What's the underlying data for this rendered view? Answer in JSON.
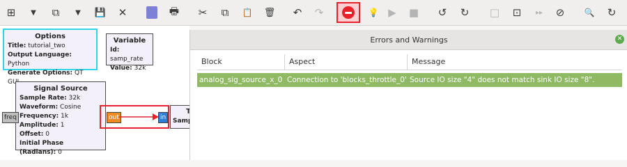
{
  "toolbar": {
    "new_icon": "⊞",
    "dropdown1": "▼",
    "open_icon": "⧉",
    "dropdown2": "▼",
    "save_icon": "💾",
    "close_icon": "✕",
    "print_icon": "🖶",
    "cut_icon": "✂",
    "copy_icon": "⧉",
    "paste_icon": "📋",
    "delete_icon": "🗑",
    "undo_icon": "↶",
    "redo_icon": "↷",
    "debug_icon": "💡",
    "run_icon": "▶",
    "stop_icon": "■",
    "rotate_ccw_icon": "↺",
    "rotate_cw_icon": "↻",
    "enable_icon": "□",
    "bypass_icon": "⊡",
    "forward_icon": "▸▸",
    "disable_icon": "⊘",
    "search_icon": "🔍",
    "reload_icon": "↻"
  },
  "blocks": {
    "options": {
      "title": "Options",
      "rows": [
        {
          "k": "Title:",
          "v": "tutorial_two"
        },
        {
          "k": "Output Language:",
          "v": "Python"
        },
        {
          "k": "Generate Options:",
          "v": "QT GUI"
        }
      ]
    },
    "variable": {
      "title": "Variable",
      "rows": [
        {
          "k": "Id:",
          "v": "samp_rate"
        },
        {
          "k": "Value:",
          "v": "32k"
        }
      ]
    },
    "signal_source": {
      "title": "Signal Source",
      "rows": [
        {
          "k": "Sample Rate:",
          "v": "32k"
        },
        {
          "k": "Waveform:",
          "v": "Cosine"
        },
        {
          "k": "Frequency:",
          "v": "1k"
        },
        {
          "k": "Amplitude:",
          "v": "1"
        },
        {
          "k": "Offset:",
          "v": "0"
        },
        {
          "k": "Initial Phase (Radians):",
          "v": "0"
        }
      ]
    },
    "throttle": {
      "title_fragment": "T",
      "row_fragment": "Samp"
    },
    "ports": {
      "freq": "freq",
      "out": "out",
      "in": "in"
    }
  },
  "errors_panel": {
    "title": "Errors and Warnings",
    "columns": [
      "Block",
      "Aspect",
      "Message"
    ],
    "rows": [
      {
        "block": "analog_sig_source_x_0",
        "aspect": "Connection to 'blocks_throttle_0'",
        "message": "Source IO size \"4\" does not match sink IO size \"8\"."
      }
    ]
  },
  "colors": {
    "error_row": "#8fba63",
    "highlight_red": "#e8202a",
    "block_bg": "#f3f0fa",
    "options_border": "#2fd6e8"
  }
}
